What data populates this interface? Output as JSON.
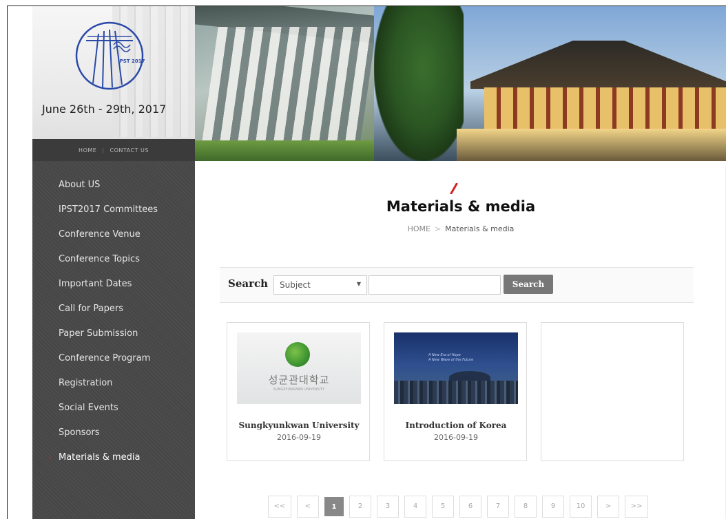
{
  "banner": {
    "logo_text": "IPST 2017",
    "dates": "June 26th - 29th, 2017",
    "topnav": {
      "home": "HOME",
      "separator": "|",
      "contact": "CONTACT US"
    }
  },
  "sidebar": {
    "items": [
      {
        "label": "About US",
        "active": false
      },
      {
        "label": "IPST2017 Committees",
        "active": false
      },
      {
        "label": "Conference Venue",
        "active": false
      },
      {
        "label": "Conference Topics",
        "active": false
      },
      {
        "label": "Important Dates",
        "active": false
      },
      {
        "label": "Call for Papers",
        "active": false
      },
      {
        "label": "Paper Submission",
        "active": false
      },
      {
        "label": "Conference Program",
        "active": false
      },
      {
        "label": "Registration",
        "active": false
      },
      {
        "label": "Social Events",
        "active": false
      },
      {
        "label": "Sponsors",
        "active": false
      },
      {
        "label": "Materials & media",
        "active": true
      }
    ],
    "active_marker": "›"
  },
  "main": {
    "title": "Materials & media",
    "breadcrumb": {
      "home": "HOME",
      "separator": ">",
      "current": "Materials & media"
    },
    "search": {
      "label": "Search",
      "select_value": "Subject",
      "select_caret": "▼",
      "input_value": "",
      "button_label": "Search"
    },
    "cards": [
      {
        "title": "Sungkyunkwan University",
        "date": "2016-09-19",
        "thumb_korean": "성균관대학교",
        "thumb_english": "SUNGKYUNKWAN UNIVERSITY"
      },
      {
        "title": "Introduction of Korea",
        "date": "2016-09-19",
        "thumb_caption_1": "A New Era of Hope",
        "thumb_caption_2": "A New Wave of the Future"
      },
      {
        "title": "",
        "date": ""
      }
    ],
    "pagination": {
      "first": "<<",
      "prev": "<",
      "pages": [
        "1",
        "2",
        "3",
        "4",
        "5",
        "6",
        "7",
        "8",
        "9",
        "10"
      ],
      "current": "1",
      "next": ">",
      "last": ">>"
    }
  },
  "colors": {
    "sidebar_bg": "#474747",
    "accent_red": "#d22222",
    "search_button": "#777777",
    "active_page": "#888888"
  }
}
